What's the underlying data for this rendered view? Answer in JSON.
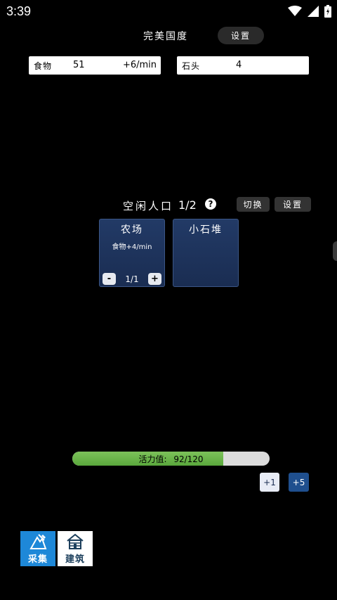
{
  "status_bar": {
    "time": "3:39",
    "icons": [
      "wifi-icon",
      "signal-icon",
      "battery-icon"
    ]
  },
  "header": {
    "title": "完美国度",
    "settings_label": "设置"
  },
  "resources": [
    {
      "name": "食物",
      "value": "51",
      "rate": "+6/min"
    },
    {
      "name": "石头",
      "value": "4",
      "rate": ""
    }
  ],
  "population": {
    "label": "空闲人口",
    "count": "1/2",
    "help": "?",
    "switch_label": "切换",
    "settings_label": "设置"
  },
  "buildings": [
    {
      "title": "农场",
      "desc": "食物+4/min",
      "minus": "-",
      "value": "1/1",
      "plus": "+"
    },
    {
      "title": "小石堆"
    }
  ],
  "vitality": {
    "label": "活力值:",
    "value": "92/120",
    "fraction": 0.7667
  },
  "boost_buttons": {
    "plus1": "+1",
    "plus5": "+5"
  },
  "tabs": [
    {
      "label": "采集",
      "icon": "gather-icon"
    },
    {
      "label": "建筑",
      "icon": "house-icon"
    }
  ],
  "colors": {
    "card_bg": "#223a66",
    "vitality_fill": "#6ab64a",
    "gather_tab": "#1e88d8",
    "plus5_button": "#1f4f8e"
  }
}
